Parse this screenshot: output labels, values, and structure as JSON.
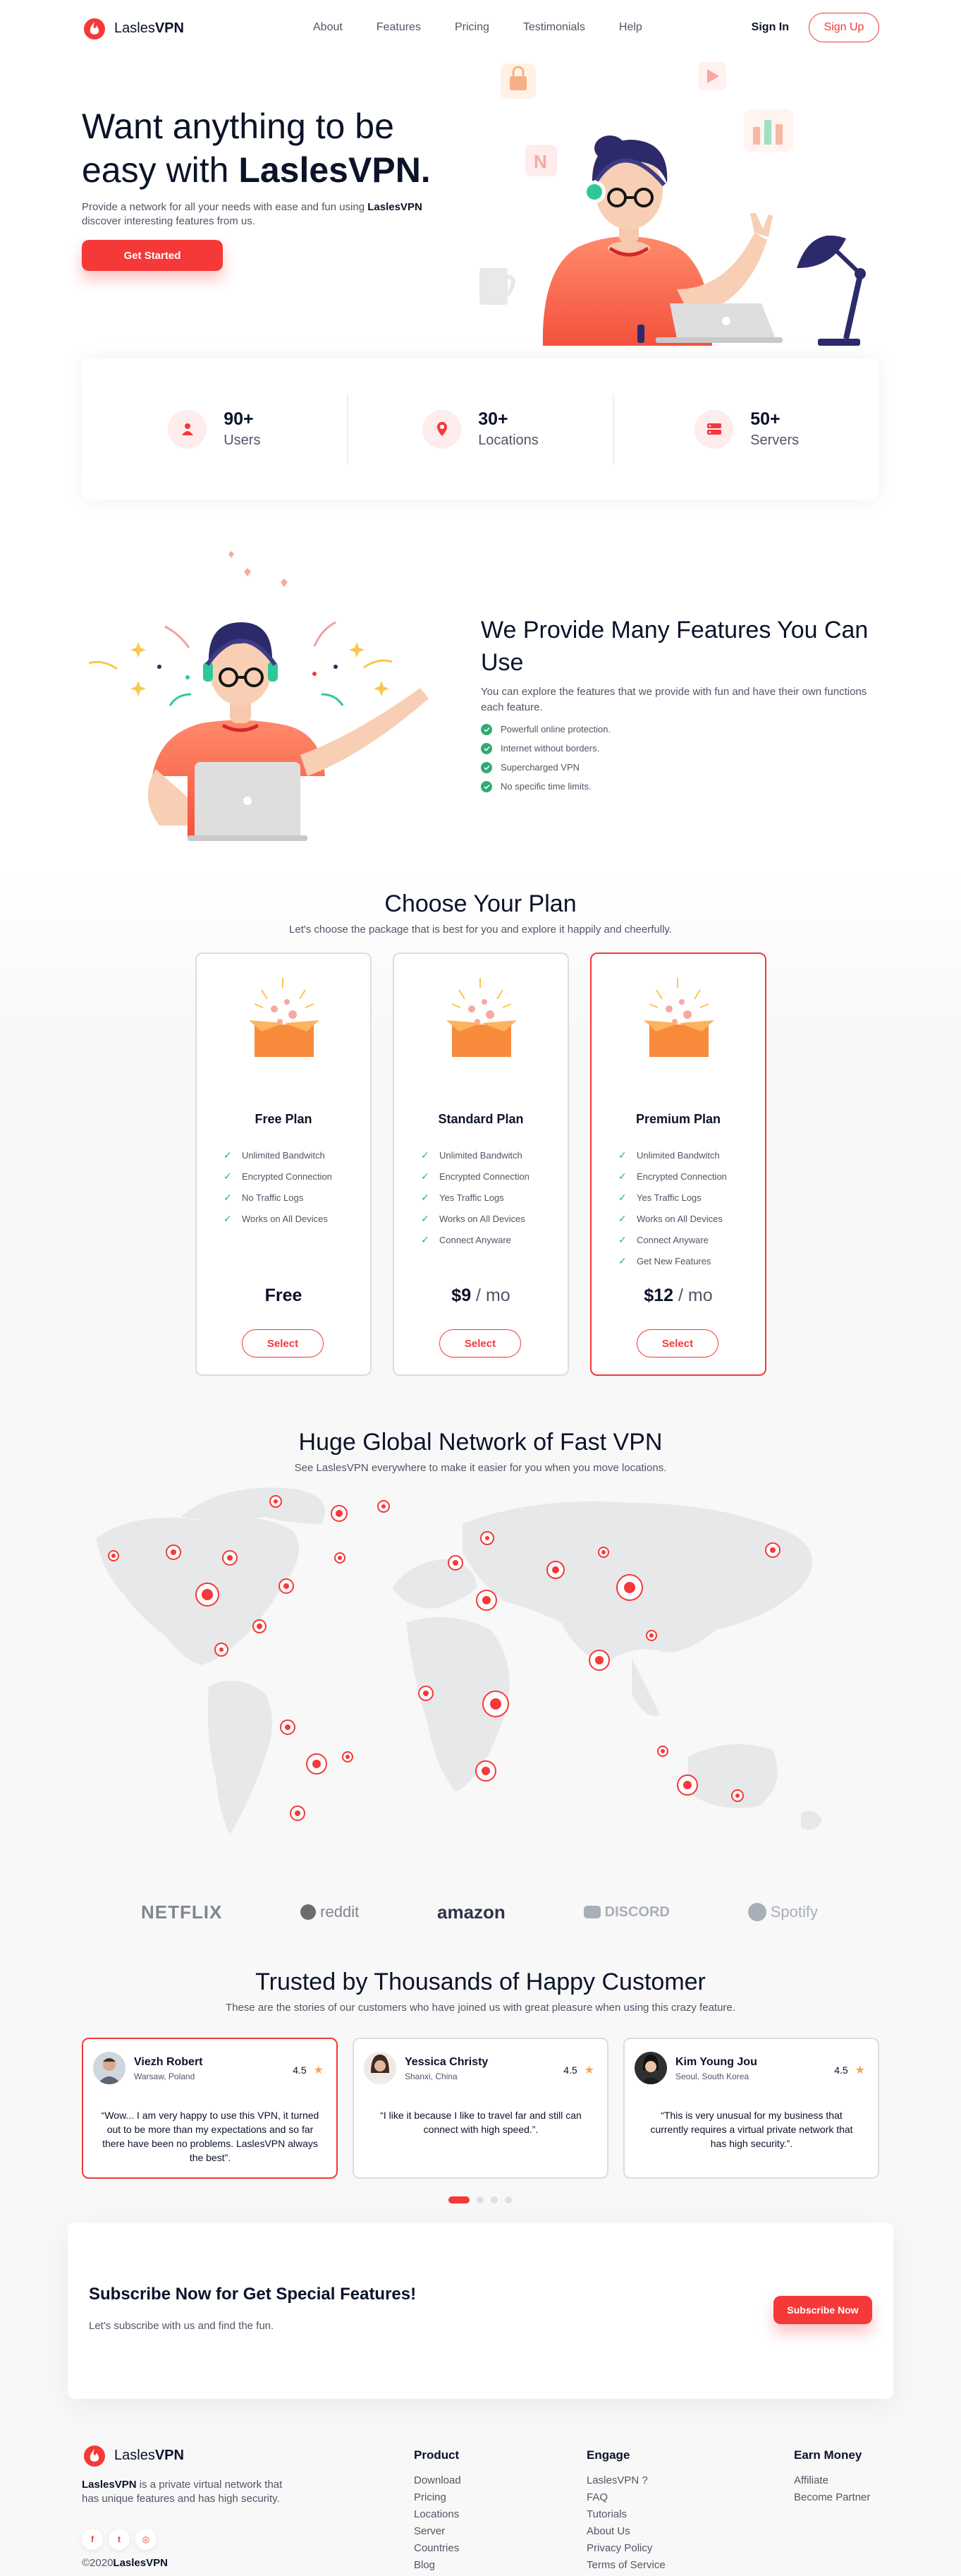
{
  "brand": {
    "name_prefix": "Lasles",
    "name_bold": "VPN"
  },
  "nav": {
    "links": [
      "About",
      "Features",
      "Pricing",
      "Testimonials",
      "Help"
    ],
    "sign_in": "Sign In",
    "sign_up": "Sign Up"
  },
  "hero": {
    "title_line1": "Want anything to be",
    "title_line2_prefix": "easy with ",
    "title_line2_bold": "LaslesVPN.",
    "desc_prefix": "Provide a network for all your needs with ease and fun using ",
    "desc_bold": "LaslesVPN",
    "desc_suffix": " discover interesting features from us.",
    "cta": "Get Started"
  },
  "stats": [
    {
      "value": "90+",
      "label": "Users",
      "icon": "user-icon"
    },
    {
      "value": "30+",
      "label": "Locations",
      "icon": "location-pin-icon"
    },
    {
      "value": "50+",
      "label": "Servers",
      "icon": "server-icon"
    }
  ],
  "features": {
    "title": "We Provide Many Features You Can Use",
    "desc": "You can explore the features that we provide with fun and have their own functions each feature.",
    "items": [
      "Powerfull online protection.",
      "Internet without borders.",
      "Supercharged VPN",
      "No specific time limits."
    ]
  },
  "plans": {
    "title": "Choose Your Plan",
    "subtitle": "Let's choose the package that is best for you and explore it happily and cheerfully.",
    "items": [
      {
        "name": "Free Plan",
        "features": [
          "Unlimited Bandwitch",
          "Encrypted Connection",
          "No Traffic Logs",
          "Works on All Devices"
        ],
        "price": "Free",
        "unit": "",
        "button": "Select"
      },
      {
        "name": "Standard Plan",
        "features": [
          "Unlimited Bandwitch",
          "Encrypted Connection",
          "Yes Traffic Logs",
          "Works on All Devices",
          "Connect Anyware"
        ],
        "price": "$9",
        "unit": " / mo",
        "button": "Select"
      },
      {
        "name": "Premium Plan",
        "features": [
          "Unlimited Bandwitch",
          "Encrypted Connection",
          "Yes Traffic Logs",
          "Works on All Devices",
          "Connect Anyware",
          "Get New Features"
        ],
        "price": "$12",
        "unit": " / mo",
        "button": "Select"
      }
    ]
  },
  "network": {
    "title": "Huge Global Network of Fast VPN",
    "subtitle": "See LaslesVPN everywhere to make it easier for you when you move locations."
  },
  "sponsors": [
    "NETFLIX",
    "reddit",
    "amazon",
    "DISCORD",
    "Spotify"
  ],
  "testimonials": {
    "title": "Trusted by Thousands of Happy Customer",
    "subtitle": "These are the stories of our customers who have joined us with great pleasure when using this crazy feature.",
    "items": [
      {
        "name": "Viezh Robert",
        "location": "Warsaw, Poland",
        "rating": "4.5",
        "quote": "“Wow... I am very happy to use this VPN, it turned out to be more than my expectations and so far there have been no problems. LaslesVPN always the best”."
      },
      {
        "name": "Yessica Christy",
        "location": "Shanxi, China",
        "rating": "4.5",
        "quote": "“I like it because I like to travel far and still can connect with high speed.”."
      },
      {
        "name": "Kim Young Jou",
        "location": "Seoul, South Korea",
        "rating": "4.5",
        "quote": "“This is very unusual for my business that currently requires a virtual private network that has high security.”."
      }
    ]
  },
  "subscribe": {
    "title": "Subscribe Now for Get Special Features!",
    "desc": "Let's subscribe with us and find the fun.",
    "button": "Subscribe Now"
  },
  "footer": {
    "about_bold": "LaslesVPN",
    "about_rest": " is a private virtual network that has unique features and has high security.",
    "copyright_prefix": "©2020",
    "copyright_bold": "LaslesVPN",
    "columns": [
      {
        "title": "Product",
        "links": [
          "Download",
          "Pricing",
          "Locations",
          "Server",
          "Countries",
          "Blog"
        ]
      },
      {
        "title": "Engage",
        "links": [
          "LaslesVPN ?",
          "FAQ",
          "Tutorials",
          "About Us",
          "Privacy Policy",
          "Terms of Service"
        ]
      },
      {
        "title": "Earn Money",
        "links": [
          "Affiliate",
          "Become Partner"
        ]
      }
    ]
  },
  "colors": {
    "accent": "#f53838",
    "text": "#0b132a",
    "muted": "#4f5665",
    "check": "#2fab73"
  }
}
